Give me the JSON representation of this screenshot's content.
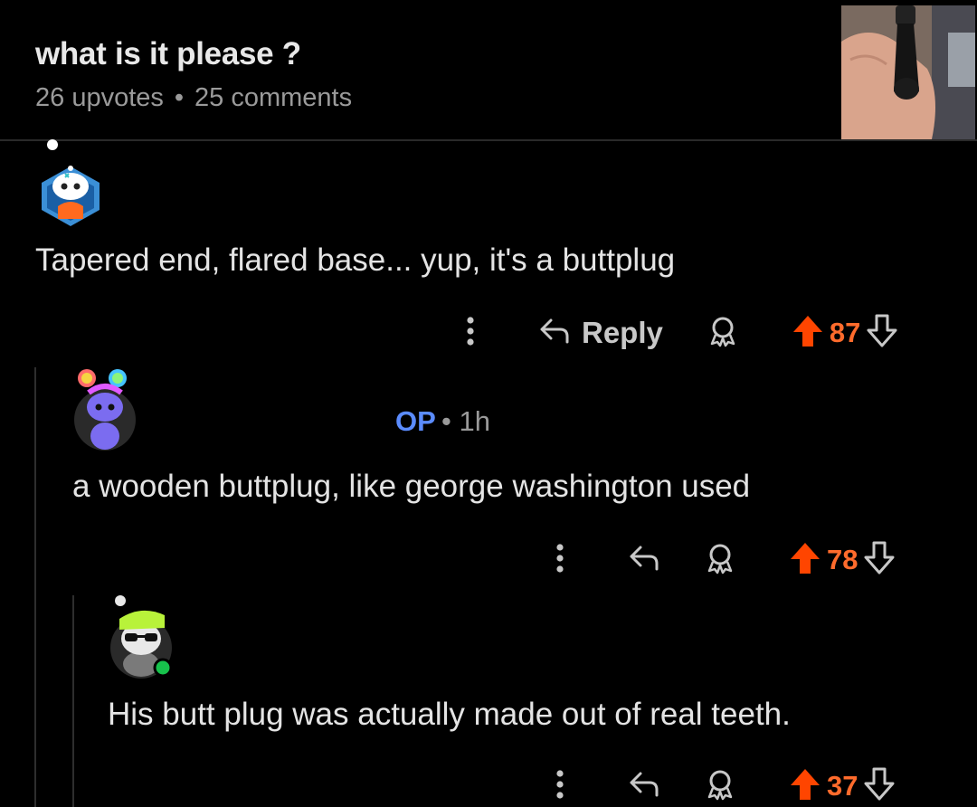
{
  "post": {
    "title": "what is it please ?",
    "upvotes": "26 upvotes",
    "separator": "•",
    "comments": "25 comments"
  },
  "comments": [
    {
      "body": "Tapered end, flared base... yup, it's a buttplug",
      "reply_label": "Reply",
      "votes": "87"
    },
    {
      "op_badge": "OP",
      "separator": "•",
      "time": "1h",
      "body": "a wooden buttplug, like george washington used",
      "votes": "78"
    },
    {
      "body": "His butt plug was actually made out of real teeth.",
      "votes": "37"
    }
  ],
  "colors": {
    "upvote": "#ff4500",
    "vote_count": "#ff6b2c",
    "op": "#5b8cff",
    "online": "#17c24c"
  }
}
